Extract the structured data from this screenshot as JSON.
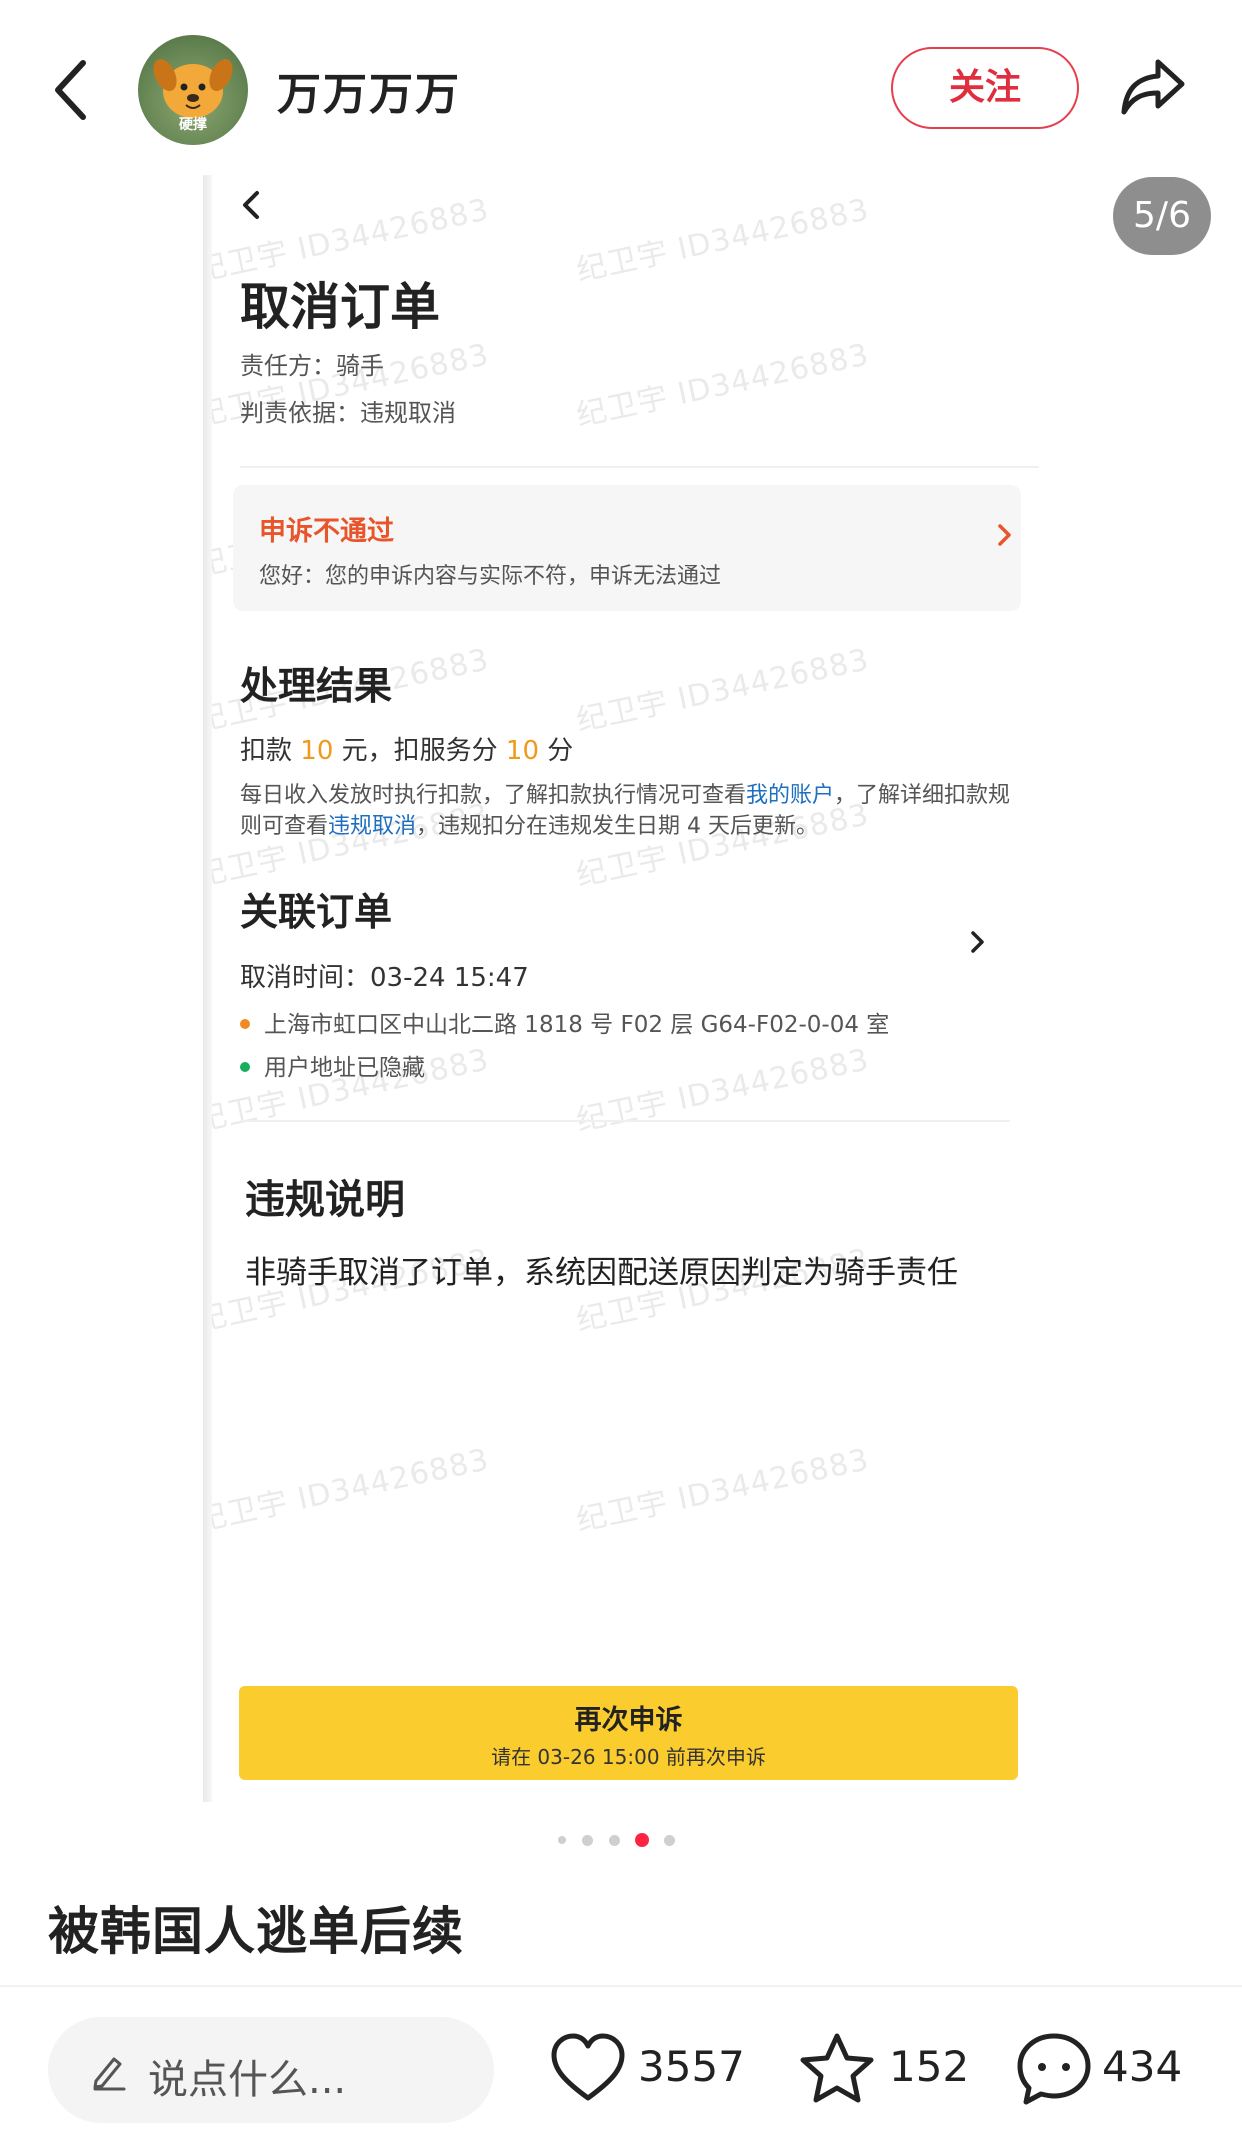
{
  "header": {
    "username": "万万万万",
    "avatar_tag": "硬撑",
    "follow_label": "关注",
    "icons": {
      "back": "back-arrow-icon",
      "share": "share-icon"
    }
  },
  "gallery": {
    "page_counter": "5/6",
    "current_index": 4,
    "total_dots": 5,
    "watermark": "纪卫宇 ID34426883"
  },
  "screenshot": {
    "title": "取消订单",
    "responsible_party": "责任方：骑手",
    "basis": "判责依据：违规取消",
    "appeal": {
      "status": "申诉不通过",
      "message": "您好：您的申诉内容与实际不符，申诉无法通过"
    },
    "result": {
      "title": "处理结果",
      "deduct_prefix": "扣款",
      "deduct_amount": "10",
      "deduct_mid": "元，扣服务分",
      "deduct_points": "10",
      "deduct_suffix": "分",
      "rules_part1": "每日收入发放时执行扣款，了解扣款执行情况可查看",
      "rules_link1": "我的账户",
      "rules_part2": "，了解详细扣款规则可查看",
      "rules_link2": "违规取消",
      "rules_part3": "，违规扣分在违规发生日期 4 天后更新。"
    },
    "linked_order": {
      "title": "关联订单",
      "cancel_time": "取消时间：03-24 15:47",
      "pickup_address": "上海市虹口区中山北二路 1818 号 F02 层 G64-F02-0-04 室",
      "user_address": "用户地址已隐藏"
    },
    "violation": {
      "title": "违规说明",
      "text": "非骑手取消了订单，系统因配送原因判定为骑手责任"
    },
    "reappeal_button": {
      "label": "再次申诉",
      "hint": "请在 03-26 15:00 前再次申诉"
    }
  },
  "note": {
    "title": "被韩国人逃单后续"
  },
  "bottom_bar": {
    "comment_placeholder": "说点什么...",
    "likes": "3557",
    "favorites": "152",
    "comments": "434"
  },
  "colors": {
    "follow": "#e02e3f",
    "appeal_status": "#e8552a",
    "amount": "#f09a1b",
    "link": "#1f6fbf",
    "reappeal_button": "#fbcc2e",
    "active_dot": "#ff2442",
    "pickup_dot": "#f08a24",
    "user_dot": "#1aad5c"
  }
}
